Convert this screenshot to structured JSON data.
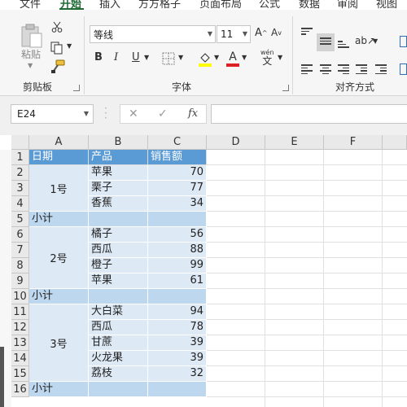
{
  "ribbon": {
    "tabs": [
      "文件",
      "开始",
      "插入",
      "方方格子",
      "页面布局",
      "公式",
      "数据",
      "审阅",
      "视图"
    ],
    "clipboard": {
      "paste_label": "粘贴",
      "group_label": "剪贴板"
    },
    "font": {
      "name": "等线",
      "size": "11",
      "group_label": "字体",
      "bold": "B",
      "italic": "I",
      "underline": "U",
      "font_color_letter": "A",
      "phonetic_label": "wén",
      "phonetic_char": "文",
      "grow": "A",
      "shrink": "A"
    },
    "alignment": {
      "group_label": "对齐方式"
    }
  },
  "formula_bar": {
    "name_box": "E24",
    "cancel": "✕",
    "enter": "✓",
    "function": "fx",
    "formula": ""
  },
  "sheet": {
    "columns": [
      "A",
      "B",
      "C",
      "D",
      "E",
      "F"
    ],
    "rows": [
      "1",
      "2",
      "3",
      "4",
      "5",
      "6",
      "7",
      "8",
      "9",
      "10",
      "11",
      "12",
      "13",
      "14",
      "15",
      "16"
    ],
    "header": {
      "date": "日期",
      "product": "产品",
      "sales": "销售额"
    },
    "groups": [
      {
        "date": "1号",
        "items": [
          {
            "product": "苹果",
            "sales": "70"
          },
          {
            "product": "栗子",
            "sales": "77"
          },
          {
            "product": "香蕉",
            "sales": "34"
          }
        ],
        "subtotal": "小计"
      },
      {
        "date": "2号",
        "items": [
          {
            "product": "橘子",
            "sales": "56"
          },
          {
            "product": "西瓜",
            "sales": "88"
          },
          {
            "product": "橙子",
            "sales": "99"
          },
          {
            "product": "苹果",
            "sales": "61"
          }
        ],
        "subtotal": "小计"
      },
      {
        "date": "3号",
        "items": [
          {
            "product": "大白菜",
            "sales": "94"
          },
          {
            "product": "西瓜",
            "sales": "78"
          },
          {
            "product": "甘蔗",
            "sales": "39"
          },
          {
            "product": "火龙果",
            "sales": "39"
          },
          {
            "product": "荔枝",
            "sales": "32"
          }
        ],
        "subtotal": "小计"
      }
    ]
  },
  "colors": {
    "header_fill": "#5b9bd5",
    "data_fill": "#dde9f5",
    "subtotal_fill": "#bdd7ee",
    "accent_green": "#1e6b35",
    "font_color_red": "#e02020"
  }
}
